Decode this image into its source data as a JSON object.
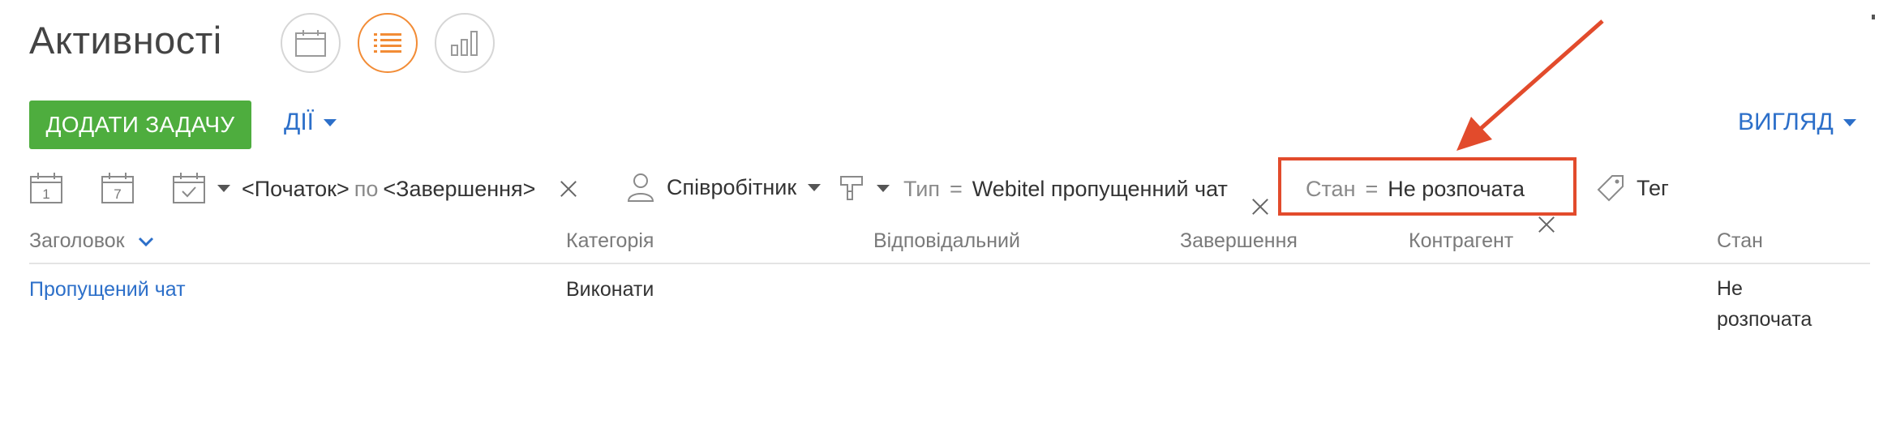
{
  "header": {
    "title": "Активності"
  },
  "toolbar": {
    "add_task_label": "ДОДАТИ ЗАДАЧУ",
    "actions_label": "ДІЇ",
    "view_label": "ВИГЛЯД"
  },
  "filters": {
    "day_icon_text": "1",
    "week_icon_text": "7",
    "period_start": "<Початок>",
    "period_by": "по",
    "period_end": "<Завершення>",
    "employee_label": "Співробітник",
    "type_label": "Тип",
    "type_eq": "=",
    "type_value": "Webitel пропущенний чат",
    "state_label": "Стан",
    "state_eq": "=",
    "state_value": "Не розпочата",
    "tag_label": "Тег"
  },
  "table": {
    "columns": [
      "Заголовок",
      "Категорія",
      "Відповідальний",
      "Завершення",
      "Контрагент",
      "Стан"
    ],
    "rows": [
      {
        "title": "Пропущений чат",
        "category": "Виконати",
        "owner": "",
        "due": "",
        "account": "",
        "state_line1": "Не",
        "state_line2": "розпочата"
      }
    ]
  },
  "colors": {
    "accent_orange": "#f28c36",
    "add_button_green": "#4ead3e",
    "link_blue": "#2c6fc9",
    "annotation_red": "#e24b2c"
  },
  "icons": [
    "calendar-icon",
    "list-icon",
    "chart-icon",
    "day-calendar-icon",
    "week-calendar-icon",
    "period-calendar-icon",
    "person-icon",
    "filter-type-icon",
    "tag-icon",
    "close-icon",
    "sort-chevron-icon"
  ]
}
